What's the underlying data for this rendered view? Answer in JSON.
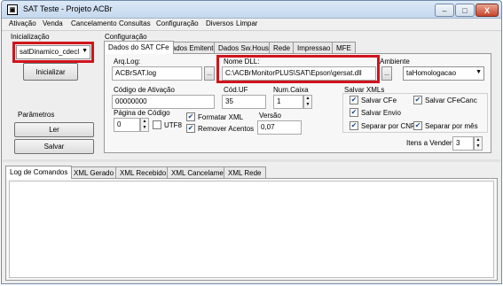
{
  "window": {
    "title": "SAT Teste - Projeto ACBr",
    "minimize": "–",
    "maximize": "□",
    "close": "X"
  },
  "menu": [
    "Ativação",
    "Venda",
    "Cancelamento",
    "Consultas",
    "Configuração",
    "Diversos",
    "Limpar"
  ],
  "init": {
    "label": "Inicialização",
    "lib_value": "satDinamico_cdecl",
    "init_button": "Inicializar"
  },
  "params": {
    "label": "Parâmetros",
    "read_button": "Ler",
    "save_button": "Salvar"
  },
  "config": {
    "label": "Configuração",
    "tabs": [
      "Dados do SAT CFe",
      "Dados Emitente",
      "Dados Sw.House",
      "Rede",
      "Impressao",
      "MFE"
    ],
    "active_tab": 0,
    "arq_log_label": "Arq.Log:",
    "arq_log_value": "ACBrSAT.log",
    "nome_dll_label": "Nome DLL:",
    "nome_dll_value": "C:\\ACBrMonitorPLUS\\SAT\\Epson\\gersat.dll",
    "ambiente_label": "Ambiente",
    "ambiente_value": "taHomologacao",
    "browse": "...",
    "codigo_ativacao_label": "Código de Ativação",
    "codigo_ativacao_value": "00000000",
    "cod_uf_label": "Cód.UF",
    "cod_uf_value": "35",
    "num_caixa_label": "Num.Caixa",
    "num_caixa_value": "1",
    "pagina_codigo_label": "Página de Código",
    "pagina_codigo_value": "0",
    "utf8_label": "UTF8",
    "utf8_checked": false,
    "formatar_xml_label": "Formatar XML",
    "formatar_xml_checked": true,
    "remover_acentos_label": "Remover Acentos",
    "remover_acentos_checked": true,
    "versao_label": "Versão",
    "versao_value": "0,07",
    "salvar_xmls_label": "Salvar XMLs",
    "salvar_cfe_label": "Salvar CFe",
    "salvar_cfe_checked": true,
    "salvar_cfecanc_label": "Salvar CFeCanc",
    "salvar_cfecanc_checked": true,
    "salvar_envio_label": "Salvar Envio",
    "salvar_envio_checked": true,
    "separar_cnpj_label": "Separar por CNPJ",
    "separar_cnpj_checked": true,
    "separar_mes_label": "Separar por mês",
    "separar_mes_checked": true,
    "itens_vender_label": "Itens a Vender:",
    "itens_vender_value": "3"
  },
  "log_tabs": [
    "Log de Comandos",
    "XML Gerado",
    "XML Recebido",
    "XML Cancelamento",
    "XML Rede"
  ],
  "log_active_tab": 0,
  "colors": {
    "highlight_box": "#d0141d",
    "check_mark": "#1d4d8c"
  }
}
